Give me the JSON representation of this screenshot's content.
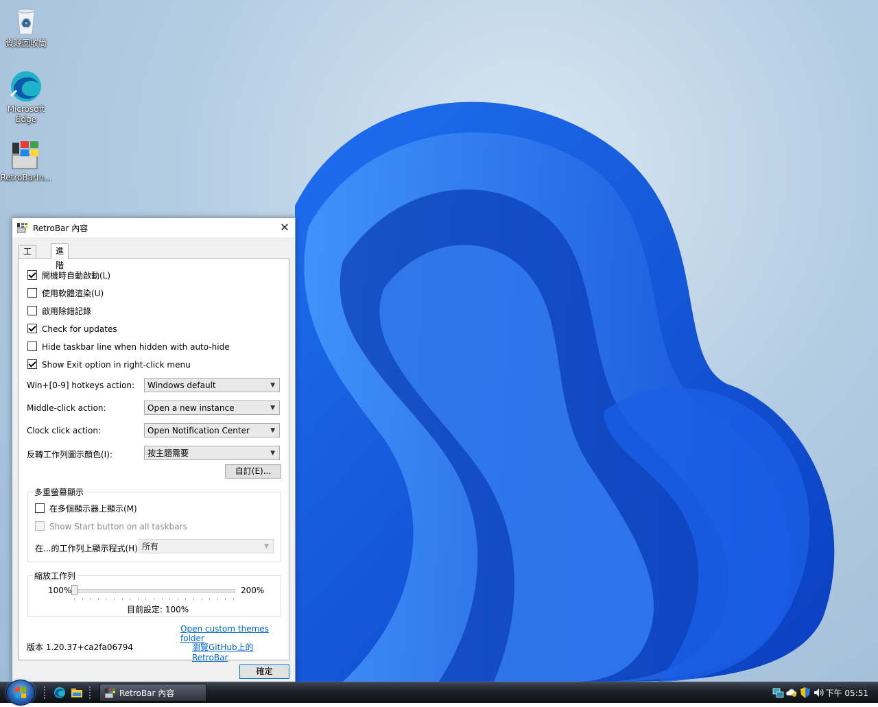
{
  "desktop": {
    "icons": [
      {
        "label": "資源回收筒",
        "icon": "recycle-bin-icon"
      },
      {
        "label": "Microsoft Edge",
        "icon": "edge-icon"
      },
      {
        "label": "RetroBarIn...",
        "icon": "retrobar-installer-icon"
      }
    ]
  },
  "dialog": {
    "title": "RetroBar 內容",
    "close_glyph": "✕",
    "tabs": [
      {
        "label": "工作列",
        "active": false
      },
      {
        "label": "進階",
        "active": true
      }
    ],
    "checkboxes": [
      {
        "label": "開機時自動啟動(L)",
        "checked": true
      },
      {
        "label": "使用軟體渲染(U)",
        "checked": false
      },
      {
        "label": "啟用除錯記錄",
        "checked": false
      },
      {
        "label": "Check for updates",
        "checked": true
      },
      {
        "label": "Hide taskbar line when hidden with auto-hide",
        "checked": false
      },
      {
        "label": "Show Exit option in right-click menu",
        "checked": true
      }
    ],
    "settings": [
      {
        "label": "Win+[0-9] hotkeys action:",
        "value": "Windows default"
      },
      {
        "label": "Middle-click action:",
        "value": "Open a new instance"
      },
      {
        "label": "Clock click action:",
        "value": "Open Notification Center"
      },
      {
        "label": "反轉工作列圖示顏色(I):",
        "value": "按主題需要"
      }
    ],
    "customize_button": "自訂(E)...",
    "multi_monitor": {
      "title": "多重螢幕顯示",
      "show_multi_label": "在多個顯示器上顯示(M)",
      "show_multi_checked": false,
      "show_start_label": "Show Start button on all taskbars",
      "show_start_enabled": false,
      "programs_label": "在...的工作列上顯示程式(H):",
      "programs_value": "所有"
    },
    "scale": {
      "title": "縮放工作列",
      "min_label": "100%",
      "max_label": "200%",
      "current_label": "目前設定: 100%",
      "value_fraction": 0
    },
    "themes_link": "Open custom themes folder",
    "version": "版本 1.20.37+ca2fa06794",
    "github_link": "瀏覽GitHub上的RetroBar",
    "ok_button": "確定"
  },
  "taskbar": {
    "task_label": "RetroBar 內容",
    "clock": "下午 05:51"
  }
}
